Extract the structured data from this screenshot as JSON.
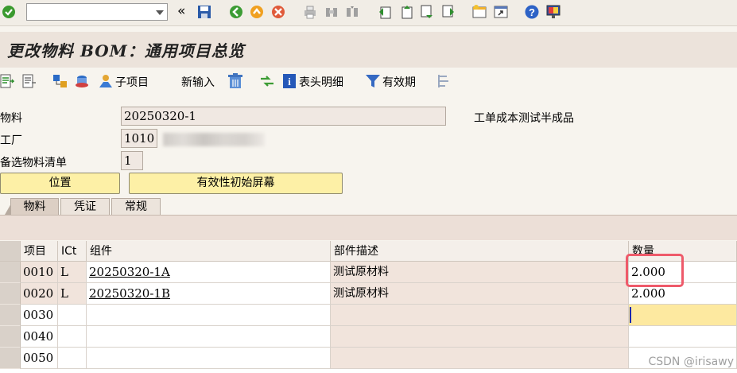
{
  "colors": {
    "accent_yellow": "#fdf0a6",
    "highlight_red": "#ee5a6a",
    "title_bg": "#ece3db"
  },
  "toolbar": {
    "icons": [
      "check-icon",
      "command-dropdown",
      "double-left-icon",
      "save-icon",
      "back-icon",
      "exit-icon",
      "cancel-icon",
      "print-icon",
      "find-icon",
      "find-next-icon",
      "first-page-icon",
      "prev-page-icon",
      "next-page-icon",
      "last-page-icon",
      "new-session-icon",
      "shortcut-icon",
      "help-icon",
      "customize-icon"
    ],
    "command_value": "",
    "double_left": "«"
  },
  "title": "更改物料 BOM：通用项目总览",
  "app_toolbar": {
    "subitem_label": "子项目",
    "new_entry_label": "新输入",
    "header_detail_label": "表头明细",
    "validity_label": "有效期"
  },
  "header": {
    "material_label": "物料",
    "material_value": "20250320-1",
    "material_desc": "工单成本测试半成品",
    "plant_label": "工厂",
    "plant_value": "1010",
    "alt_bom_label": "备选物料清单",
    "alt_bom_value": "1",
    "position_button": "位置",
    "validity_screen_button": "有效性初始屏幕"
  },
  "tabs": [
    {
      "label": "物料",
      "active": true
    },
    {
      "label": "凭证",
      "active": false
    },
    {
      "label": "常规",
      "active": false
    }
  ],
  "table": {
    "columns": [
      "项目",
      "ICt",
      "组件",
      "部件描述",
      "数量"
    ],
    "rows": [
      {
        "item": "0010",
        "ict": "L",
        "component": "20250320-1A",
        "description": "测试原材料",
        "quantity": "2.000"
      },
      {
        "item": "0020",
        "ict": "L",
        "component": "20250320-1B",
        "description": "测试原材料",
        "quantity": "2.000"
      },
      {
        "item": "0030",
        "ict": "",
        "component": "",
        "description": "",
        "quantity": ""
      },
      {
        "item": "0040",
        "ict": "",
        "component": "",
        "description": "",
        "quantity": ""
      },
      {
        "item": "0050",
        "ict": "",
        "component": "",
        "description": "",
        "quantity": ""
      }
    ]
  },
  "watermark": "CSDN @irisawy"
}
